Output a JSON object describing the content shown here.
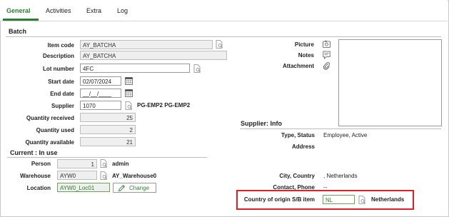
{
  "tabs": [
    {
      "label": "General",
      "active": true
    },
    {
      "label": "Activities",
      "active": false
    },
    {
      "label": "Extra",
      "active": false
    },
    {
      "label": "Log",
      "active": false
    }
  ],
  "batch": {
    "title": "Batch",
    "item_code": {
      "label": "Item code",
      "value": "AY_BATCHA"
    },
    "description": {
      "label": "Description",
      "value": "AY_BATCHA"
    },
    "lot_number": {
      "label": "Lot number",
      "value": "4FC"
    },
    "start_date": {
      "label": "Start date",
      "value": "02/07/2024"
    },
    "end_date": {
      "label": "End date",
      "value": "__/__/____"
    },
    "supplier": {
      "label": "Supplier",
      "value": "1070",
      "name": "PG-EMP2 PG-EMP2"
    },
    "quantity_received": {
      "label": "Quantity received",
      "value": "25"
    },
    "quantity_used": {
      "label": "Quantity used",
      "value": "2"
    },
    "quantity_available": {
      "label": "Quantity available",
      "value": "21"
    },
    "picture_label": "Picture",
    "notes_label": "Notes",
    "attachment_label": "Attachment"
  },
  "current": {
    "title": "Current : In use",
    "person": {
      "label": "Person",
      "value": "1",
      "name": "admin"
    },
    "warehouse": {
      "label": "Warehouse",
      "value": "AYW0",
      "name": "AY_Warehouse0"
    },
    "location": {
      "label": "Location",
      "value": "AYW0_Loc01",
      "change_label": "Change"
    }
  },
  "supplier_info": {
    "title": "Supplier: Info",
    "type_status": {
      "label": "Type, Status",
      "value": "Employee, Active"
    },
    "address": {
      "label": "Address",
      "value": ""
    },
    "city_country": {
      "label": "City, Country",
      "value": ", Netherlands"
    },
    "contact_phone": {
      "label": "Contact, Phone",
      "value": "--"
    },
    "country_origin": {
      "label": "Country of origin S/B item",
      "value": "NL",
      "name": "Netherlands"
    }
  },
  "colors": {
    "accent": "#2e7d32",
    "highlight_border": "#e02020",
    "readonly_bg": "#efefef"
  },
  "icons": {
    "lookup": "lookup-page-icon",
    "calendar": "calendar-icon",
    "picture": "picture-icon",
    "notes": "notes-icon",
    "attachment": "paperclip-icon",
    "change": "pencil-icon"
  }
}
